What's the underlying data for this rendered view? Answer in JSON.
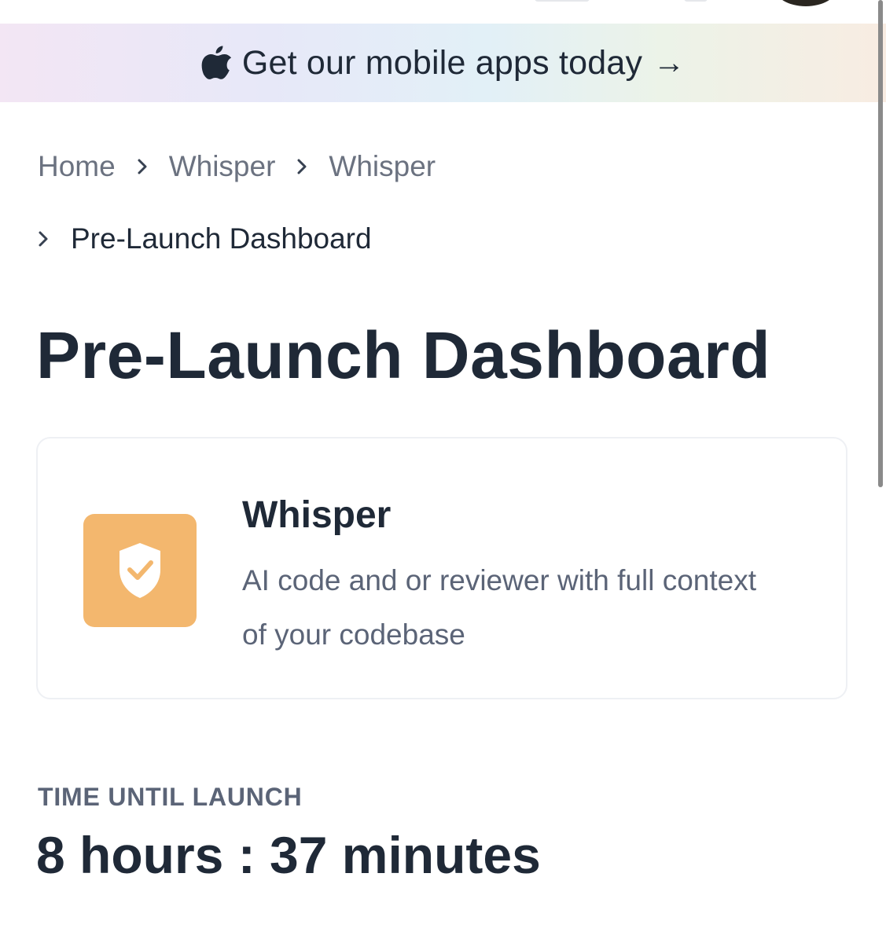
{
  "promo_banner": {
    "text": "Get our mobile apps today",
    "arrow": "→",
    "icon": "apple-icon"
  },
  "breadcrumb": {
    "items": [
      {
        "label": "Home"
      },
      {
        "label": "Whisper"
      },
      {
        "label": "Whisper"
      },
      {
        "label": "Pre-Launch Dashboard"
      }
    ],
    "separator_icon": "chevron-right-icon"
  },
  "page": {
    "title": "Pre-Launch Dashboard"
  },
  "product": {
    "name": "Whisper",
    "description": "AI code and or reviewer with full context of your codebase",
    "logo_icon": "shield-check-icon",
    "logo_color": "#f3b76e"
  },
  "countdown": {
    "label": "TIME UNTIL LAUNCH",
    "value": "8 hours : 37 minutes"
  }
}
